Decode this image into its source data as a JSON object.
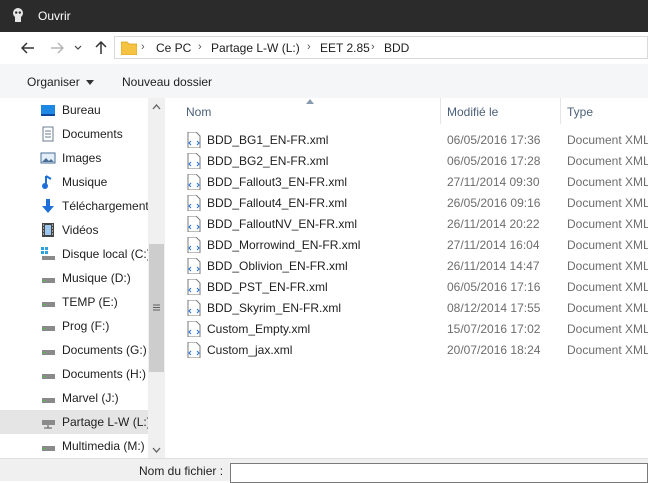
{
  "window": {
    "title": "Ouvrir"
  },
  "address": {
    "crumbs": [
      "Ce PC",
      "Partage L-W (L:)",
      "EET 2.85",
      "BDD"
    ]
  },
  "toolbar": {
    "organise_label": "Organiser",
    "new_folder_label": "Nouveau dossier"
  },
  "sidebar": {
    "items": [
      {
        "label": "Bureau",
        "icon": "desktop-icon"
      },
      {
        "label": "Documents",
        "icon": "documents-icon"
      },
      {
        "label": "Images",
        "icon": "pictures-icon"
      },
      {
        "label": "Musique",
        "icon": "music-icon"
      },
      {
        "label": "Téléchargements",
        "icon": "downloads-icon"
      },
      {
        "label": "Vidéos",
        "icon": "videos-icon"
      },
      {
        "label": "Disque local (C:)",
        "icon": "system-drive-icon"
      },
      {
        "label": "Musique (D:)",
        "icon": "drive-icon"
      },
      {
        "label": "TEMP (E:)",
        "icon": "drive-icon"
      },
      {
        "label": "Prog (F:)",
        "icon": "drive-icon"
      },
      {
        "label": "Documents (G:)",
        "icon": "drive-icon"
      },
      {
        "label": "Documents (H:)",
        "icon": "drive-icon"
      },
      {
        "label": "Marvel (J:)",
        "icon": "drive-icon"
      },
      {
        "label": "Partage L-W (L:)",
        "icon": "network-drive-icon",
        "selected": true
      },
      {
        "label": "Multimedia (M:)",
        "icon": "drive-icon"
      }
    ]
  },
  "columns": {
    "name": "Nom",
    "modified": "Modifié le",
    "type": "Type"
  },
  "files": [
    {
      "name": "BDD_BG1_EN-FR.xml",
      "modified": "06/05/2016 17:36",
      "type": "Document XML"
    },
    {
      "name": "BDD_BG2_EN-FR.xml",
      "modified": "06/05/2016 17:28",
      "type": "Document XML"
    },
    {
      "name": "BDD_Fallout3_EN-FR.xml",
      "modified": "27/11/2014 09:30",
      "type": "Document XML"
    },
    {
      "name": "BDD_Fallout4_EN-FR.xml",
      "modified": "26/05/2016 09:16",
      "type": "Document XML"
    },
    {
      "name": "BDD_FalloutNV_EN-FR.xml",
      "modified": "26/11/2014 20:22",
      "type": "Document XML"
    },
    {
      "name": "BDD_Morrowind_EN-FR.xml",
      "modified": "27/11/2014 16:04",
      "type": "Document XML"
    },
    {
      "name": "BDD_Oblivion_EN-FR.xml",
      "modified": "26/11/2014 14:47",
      "type": "Document XML"
    },
    {
      "name": "BDD_PST_EN-FR.xml",
      "modified": "06/05/2016 17:16",
      "type": "Document XML"
    },
    {
      "name": "BDD_Skyrim_EN-FR.xml",
      "modified": "08/12/2014 17:55",
      "type": "Document XML"
    },
    {
      "name": "Custom_Empty.xml",
      "modified": "15/07/2016 17:02",
      "type": "Document XML"
    },
    {
      "name": "Custom_jax.xml",
      "modified": "20/07/2016 18:24",
      "type": "Document XML"
    }
  ],
  "footer": {
    "filename_label": "Nom du fichier :",
    "filename_value": ""
  },
  "colors": {
    "titlebar": "#2b2b2b",
    "header_text": "#4c607a",
    "selected": "#e5e5e5",
    "folder": "#f5c242"
  }
}
